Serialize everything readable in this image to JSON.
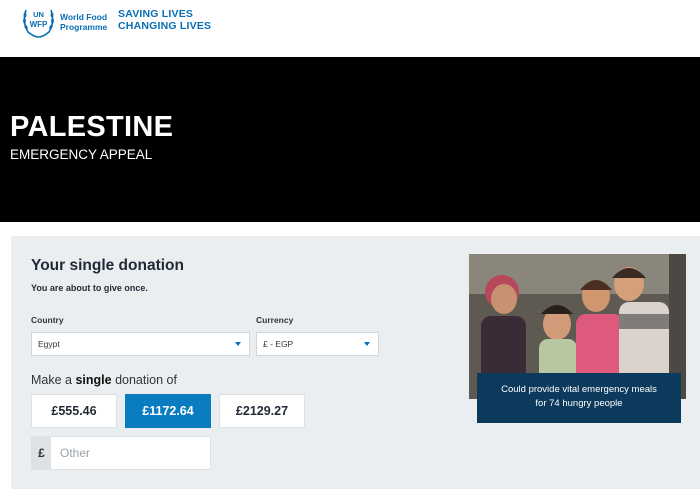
{
  "header": {
    "logo_un": "UN",
    "logo_wfp": "WFP",
    "logo_name_line1": "World Food",
    "logo_name_line2": "Programme",
    "tagline_line1": "SAVING LIVES",
    "tagline_line2": "CHANGING LIVES"
  },
  "hero": {
    "title": "PALESTINE",
    "subtitle": "EMERGENCY APPEAL"
  },
  "donation": {
    "title": "Your single donation",
    "subtitle": "You are about to give once.",
    "country_label": "Country",
    "country_value": "Egypt",
    "currency_label": "Currency",
    "currency_value": "£ - EGP",
    "make_prefix": "Make a ",
    "make_bold": "single",
    "make_suffix": " donation of",
    "amounts": [
      {
        "label": "£555.46",
        "selected": false
      },
      {
        "label": "£1172.64",
        "selected": true
      },
      {
        "label": "£2129.27",
        "selected": false
      }
    ],
    "other_prefix": "£",
    "other_placeholder": "Other"
  },
  "photo": {
    "caption_line1": "Could provide vital emergency meals",
    "caption_line2": "for 74 hungry people"
  },
  "colors": {
    "brand_blue": "#0a6eb4",
    "selected_amount": "#0a7dc2",
    "caption_bg": "#0b3a5c",
    "hero_bg": "#000000"
  }
}
